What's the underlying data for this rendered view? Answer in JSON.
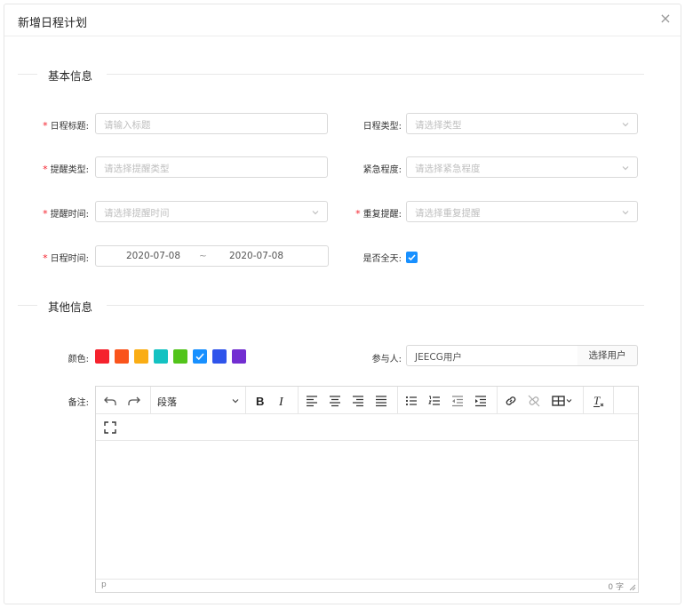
{
  "modal": {
    "title": "新增日程计划",
    "close_symbol": "×"
  },
  "sections": {
    "basic": "基本信息",
    "other": "其他信息"
  },
  "form": {
    "title_label": "日程标题:",
    "title_placeholder": "请输入标题",
    "type_label": "日程类型:",
    "type_placeholder": "请选择类型",
    "remind_type_label": "提醒类型:",
    "remind_type_placeholder": "请选择提醒类型",
    "urgency_label": "紧急程度:",
    "urgency_placeholder": "请选择紧急程度",
    "remind_time_label": "提醒时间:",
    "remind_time_placeholder": "请选择提醒时间",
    "repeat_label": "重复提醒:",
    "repeat_placeholder": "请选择重复提醒",
    "schedule_time_label": "日程时间:",
    "start_date": "2020-07-08",
    "date_separator": "~",
    "end_date": "2020-07-08",
    "all_day_label": "是否全天:",
    "all_day_checked": true,
    "required_mark": "*",
    "color_label": "颜色:",
    "colors": [
      "#f5222d",
      "#fa541c",
      "#faad14",
      "#13c2c2",
      "#52c41a",
      "#1890ff",
      "#2f54eb",
      "#722ed1"
    ],
    "selected_color_index": 5,
    "participants_label": "参与人:",
    "participants_value": "JEECG用户",
    "select_user_button": "选择用户",
    "remark_label": "备注:"
  },
  "editor": {
    "block_format": "段落",
    "status_path": "p",
    "word_count": "0 字",
    "toolbar_icons": [
      "undo-icon",
      "redo-icon",
      "bold-icon",
      "italic-icon",
      "align-left-icon",
      "align-center-icon",
      "align-right-icon",
      "align-justify-icon",
      "bullet-list-icon",
      "numbered-list-icon",
      "outdent-icon",
      "indent-icon",
      "link-icon",
      "unlink-icon",
      "table-icon",
      "clear-format-icon",
      "fullscreen-icon"
    ]
  }
}
